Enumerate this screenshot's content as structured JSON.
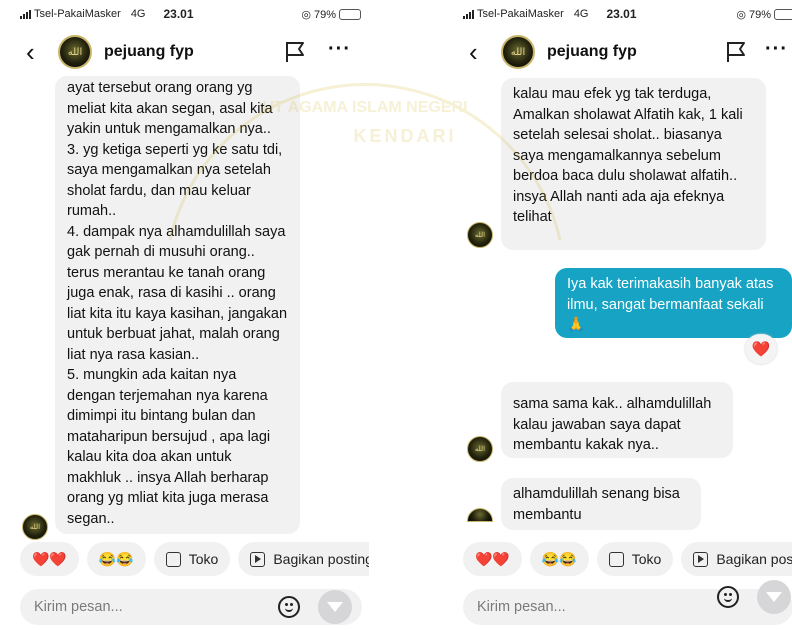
{
  "status_bar": {
    "carrier": "Tsel-PakaiMasker",
    "network": "4G",
    "time": "23.01",
    "battery": "79%",
    "battery_level": 0.79
  },
  "header": {
    "username": "pejuang fyp"
  },
  "watermark": {
    "line1": "UT AGAMA ISLAM NEGERI",
    "line2": "KENDARI"
  },
  "left_screen": {
    "message": "ayat tersebut orang orang yg meliat kita akan segan, asal kita yakin untuk mengamalkan nya..\n3. yg ketiga seperti yg ke satu tdi, saya mengamalkan nya setelah sholat fardu, dan mau keluar rumah..\n4. dampak nya alhamdulillah saya gak pernah di musuhi orang.. terus merantau ke tanah orang juga enak, rasa di kasihi .. orang liat kita itu kaya kasihan, jangakan untuk berbuat jahat, malah orang liat nya rasa kasian..\n5. mungkin ada kaitan nya dengan terjemahan nya karena dimimpi itu bintang bulan dan mataharipun bersujud , apa lagi kalau kita doa akan untuk makhluk .. insya Allah berharap orang yg mliat kita juga merasa segan.."
  },
  "right_screen": {
    "messages": [
      {
        "type": "received",
        "text": "kalau mau efek yg tak terduga, Amalkan sholawat Alfatih kak, 1 kali setelah selesai sholat.. biasanya saya mengamalkannya sebelum berdoa baca dulu sholawat alfatih.. insya Allah nanti ada aja efeknya telihat"
      },
      {
        "type": "sent",
        "text": "Iya kak terimakasih banyak atas ilmu, sangat bermanfaat sekali 🙏"
      },
      {
        "type": "received",
        "text": "sama sama kak.. alhamdulillah kalau jawaban saya dapat membantu kakak nya.."
      },
      {
        "type": "received",
        "text": "alhamdulillah senang bisa membantu"
      }
    ],
    "reaction": "❤️"
  },
  "quick_replies": {
    "hearts": "❤️❤️",
    "laugh": "😂😂",
    "toko": "Toko",
    "share": "Bagikan postingan"
  },
  "composer": {
    "placeholder": "Kirim pesan..."
  },
  "avatar_text": "الله",
  "colors": {
    "sent_bubble": "#16a3c4",
    "received_bubble": "#f1f1f2",
    "watermark": "#c9a800"
  }
}
